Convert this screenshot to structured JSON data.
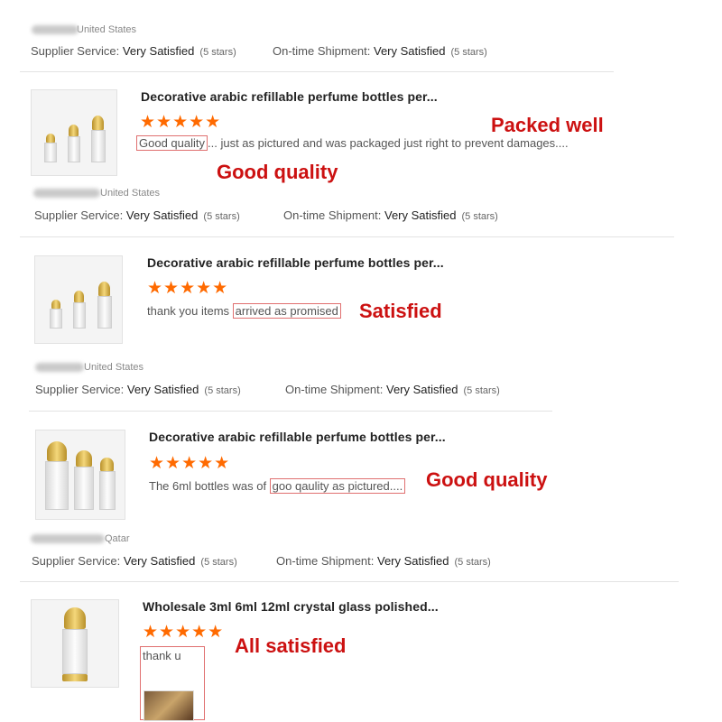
{
  "colors": {
    "star": "#ff6a00",
    "annotation": "#cc1111",
    "highlight_border": "#e07070"
  },
  "icons": {
    "star": "star-icon",
    "product": "perfume-bottle-image"
  },
  "labels": {
    "supplier_service": "Supplier Service:",
    "ontime_shipment": "On-time Shipment:"
  },
  "reviews": [
    {
      "location": "United States",
      "supplier_value": "Very Satisfied",
      "supplier_stars": "(5 stars)",
      "shipment_value": "Very Satisfied",
      "shipment_stars": "(5 stars)"
    },
    {
      "title": "Decorative arabic refillable perfume bottles per...",
      "stars": "★★★★★",
      "text_highlight": "Good quality",
      "text_rest": "... just as pictured and was packaged just right to prevent damages....",
      "annotation_1": "Packed well",
      "annotation_2": "Good quality",
      "location": "United States",
      "supplier_value": "Very Satisfied",
      "supplier_stars": "(5 stars)",
      "shipment_value": "Very Satisfied",
      "shipment_stars": "(5 stars)"
    },
    {
      "title": "Decorative arabic refillable perfume bottles per...",
      "stars": "★★★★★",
      "text_before": "thank you items ",
      "text_highlight": "arrived as promised",
      "annotation_1": "Satisfied",
      "location": "United States",
      "supplier_value": "Very Satisfied",
      "supplier_stars": "(5 stars)",
      "shipment_value": "Very Satisfied",
      "shipment_stars": "(5 stars)"
    },
    {
      "title": "Decorative arabic refillable perfume bottles per...",
      "stars": "★★★★★",
      "text_before": "The 6ml bottles was of ",
      "text_highlight": "goo qaulity as pictured....",
      "annotation_1": "Good quality",
      "location": "Qatar",
      "supplier_value": "Very Satisfied",
      "supplier_stars": "(5 stars)",
      "shipment_value": "Very Satisfied",
      "shipment_stars": "(5 stars)"
    },
    {
      "title": "Wholesale 3ml 6ml 12ml crystal glass polished...",
      "stars": "★★★★★",
      "text_highlight": "thank u",
      "annotation_1": "All satisfied"
    }
  ]
}
